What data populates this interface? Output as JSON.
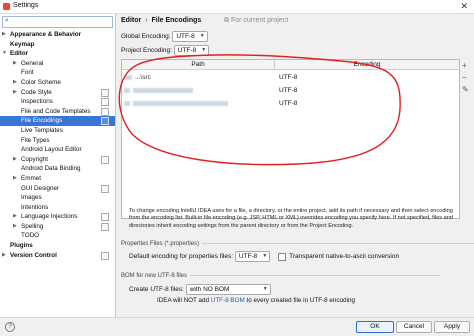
{
  "window": {
    "title": "Settings"
  },
  "search": {
    "placeholder": ""
  },
  "tree": [
    {
      "label": "Appearance & Behavior",
      "bold": true,
      "arrow": "▶",
      "indent": 0
    },
    {
      "label": "Keymap",
      "bold": true,
      "arrow": "",
      "indent": 0
    },
    {
      "label": "Editor",
      "bold": true,
      "arrow": "▼",
      "indent": 0
    },
    {
      "label": "General",
      "bold": false,
      "arrow": "▶",
      "indent": 1
    },
    {
      "label": "Font",
      "bold": false,
      "arrow": "",
      "indent": 1
    },
    {
      "label": "Color Scheme",
      "bold": false,
      "arrow": "▶",
      "indent": 1
    },
    {
      "label": "Code Style",
      "bold": false,
      "arrow": "▶",
      "indent": 1,
      "tag": true
    },
    {
      "label": "Inspections",
      "bold": false,
      "arrow": "",
      "indent": 1,
      "tag": true
    },
    {
      "label": "File and Code Templates",
      "bold": false,
      "arrow": "",
      "indent": 1,
      "tag": true
    },
    {
      "label": "File Encodings",
      "bold": false,
      "arrow": "",
      "indent": 1,
      "tag": true,
      "selected": true
    },
    {
      "label": "Live Templates",
      "bold": false,
      "arrow": "",
      "indent": 1
    },
    {
      "label": "File Types",
      "bold": false,
      "arrow": "",
      "indent": 1
    },
    {
      "label": "Android Layout Editor",
      "bold": false,
      "arrow": "",
      "indent": 1
    },
    {
      "label": "Copyright",
      "bold": false,
      "arrow": "▶",
      "indent": 1,
      "tag": true
    },
    {
      "label": "Android Data Binding",
      "bold": false,
      "arrow": "",
      "indent": 1
    },
    {
      "label": "Emmet",
      "bold": false,
      "arrow": "▶",
      "indent": 1
    },
    {
      "label": "GUI Designer",
      "bold": false,
      "arrow": "",
      "indent": 1,
      "tag": true
    },
    {
      "label": "Images",
      "bold": false,
      "arrow": "",
      "indent": 1
    },
    {
      "label": "Intentions",
      "bold": false,
      "arrow": "",
      "indent": 1
    },
    {
      "label": "Language Injections",
      "bold": false,
      "arrow": "▶",
      "indent": 1,
      "tag": true
    },
    {
      "label": "Spelling",
      "bold": false,
      "arrow": "▶",
      "indent": 1,
      "tag": true
    },
    {
      "label": "TODO",
      "bold": false,
      "arrow": "",
      "indent": 1
    },
    {
      "label": "Plugins",
      "bold": true,
      "arrow": "",
      "indent": 0
    },
    {
      "label": "Version Control",
      "bold": true,
      "arrow": "▶",
      "indent": 0,
      "tag": true
    }
  ],
  "breadcrumb": {
    "parent": "Editor",
    "sep": "›",
    "current": "File Encodings",
    "hint": "For current project"
  },
  "global_encoding": {
    "label": "Global Encoding:",
    "value": "UTF-8"
  },
  "project_encoding": {
    "label": "Project Encoding:",
    "value": "UTF-8"
  },
  "table": {
    "col_path": "Path",
    "col_encoding": "Encoding",
    "rows": [
      {
        "path_tail": "...\\src",
        "encoding": "UTF-8"
      },
      {
        "path_tail": "",
        "encoding": "UTF-8"
      },
      {
        "path_tail": "",
        "encoding": "UTF-8"
      }
    ],
    "tools": [
      "+",
      "−",
      "✎"
    ]
  },
  "description": "To change encoding IntelliJ IDEA uses for a file, a directory, or the entire project, add its path if necessary and then select encoding from the encoding list. Built-in file encoding (e.g. JSP, HTML or XML) overrides encoding you specify here. If not specified, files and directories inherit encoding settings from the parent directory or from the Project Encoding.",
  "properties": {
    "section": "Properties Files (*.properties)",
    "default_label": "Default encoding for properties files:",
    "default_value": "UTF-8",
    "transparent_label": "Transparent native-to-ascii conversion"
  },
  "bom": {
    "section": "BOM for new UTF-8 files",
    "create_label": "Create UTF-8 files:",
    "create_value": "with NO BOM",
    "note_prefix": "IDEA will NOT add",
    "note_link": "UTF-8 BOM",
    "note_suffix": "to every created file in UTF-8 encoding"
  },
  "buttons": {
    "help": "?",
    "ok": "OK",
    "cancel": "Cancel",
    "apply": "Apply"
  }
}
